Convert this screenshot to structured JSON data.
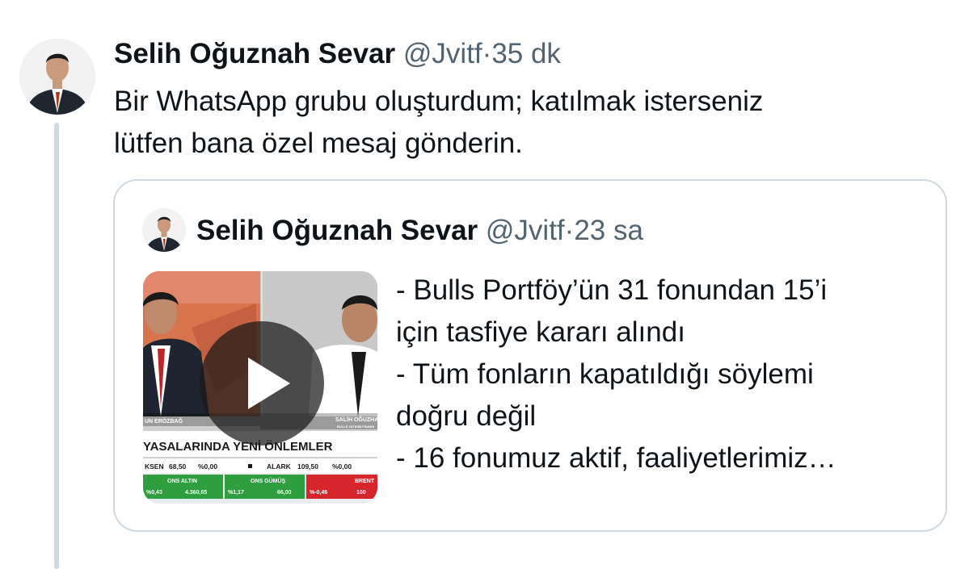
{
  "tweet": {
    "author_name": "Selih Oğuznah Sevar",
    "handle": "@Jvitf",
    "separator": "·",
    "time": "35 dk",
    "text_lines": [
      "Bir WhatsApp grubu oluşturdum; katılmak isterseniz",
      "lütfen bana özel mesaj gönderin."
    ]
  },
  "quoted_tweet": {
    "author_name": "Selih Oğuznah Sevar",
    "handle": "@Jvitf",
    "separator": "·",
    "time": "23 sa",
    "text_lines": [
      "- Bulls Portföy’ün 31 fonundan 15’i",
      "için tasfiye kararı alındı",
      "- Tüm fonların kapatıldığı söylemi",
      "doğru değil",
      "- 16 fonumuz aktif, faaliyetlerimiz…"
    ],
    "media": {
      "type": "video",
      "play_icon": "play-icon",
      "lower_third_left": "UN ERÖZBAĞ",
      "lower_third_right": "SALİH OĞUZHAN",
      "lower_third_right_sub": "BULLS YATIRIM FİNANS",
      "headline": "YASALARINDA YENİ ÖNLEMLER",
      "ticker_row1": [
        {
          "label": "KSEN",
          "value": "68,50",
          "change": "%0,00"
        },
        {
          "label": "ALARK",
          "value": "109,50",
          "change": "%0,00"
        }
      ],
      "ticker_row2": [
        {
          "label": "ONS ALTIN",
          "change": "%0,43",
          "value": "4.360,65",
          "color": "#2e9e3e"
        },
        {
          "label": "ONS GÜMÜŞ",
          "change": "%1,17",
          "value": "66,00",
          "color": "#2e9e3e"
        },
        {
          "label": "BRENT",
          "change": "%-0,46",
          "value": "100",
          "color": "#d6262b"
        }
      ]
    }
  },
  "colors": {
    "text": "#0f1419",
    "muted": "#536471",
    "border": "#cfd9de"
  }
}
